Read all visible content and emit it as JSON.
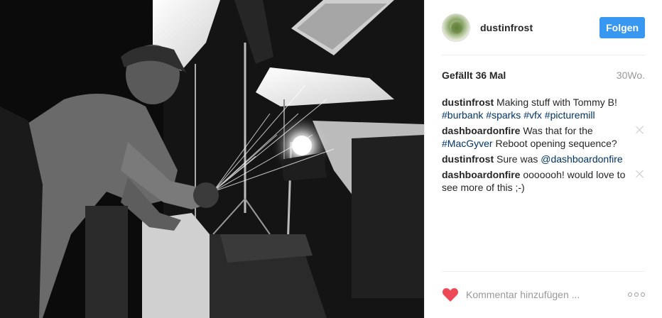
{
  "post": {
    "image_alt": "Black and white photo of a man grinding metal with sparks under studio lights"
  },
  "header": {
    "username": "dustinfrost",
    "follow_label": "Folgen"
  },
  "meta": {
    "likes": "Gefällt 36 Mal",
    "time": "30Wo."
  },
  "comments": [
    {
      "author": "dustinfrost",
      "parts": [
        {
          "type": "text",
          "value": " Making stuff with Tommy B! "
        },
        {
          "type": "tag",
          "value": "#burbank"
        },
        {
          "type": "text",
          "value": " "
        },
        {
          "type": "tag",
          "value": "#sparks"
        },
        {
          "type": "text",
          "value": " "
        },
        {
          "type": "tag",
          "value": "#vfx"
        },
        {
          "type": "text",
          "value": " "
        },
        {
          "type": "tag",
          "value": "#picturemill"
        }
      ],
      "removable": false
    },
    {
      "author": "dashboardonfire",
      "parts": [
        {
          "type": "text",
          "value": " Was that for the "
        },
        {
          "type": "tag",
          "value": "#MacGyver"
        },
        {
          "type": "text",
          "value": " Reboot opening sequence?"
        }
      ],
      "removable": true
    },
    {
      "author": "dustinfrost",
      "parts": [
        {
          "type": "text",
          "value": " Sure was "
        },
        {
          "type": "tag",
          "value": "@dashboardonfire"
        }
      ],
      "removable": false
    },
    {
      "author": "dashboardonfire",
      "parts": [
        {
          "type": "text",
          "value": " ooooooh! would love to see more of this ;-)"
        }
      ],
      "removable": true
    }
  ],
  "footer": {
    "comment_placeholder": "Kommentar hinzufügen ..."
  },
  "colors": {
    "follow_button": "#3897f0",
    "heart": "#ed4956",
    "tag": "#003569",
    "muted": "#999999"
  },
  "icons": {
    "like": "heart-icon",
    "more": "more-options-icon",
    "remove": "close-icon"
  }
}
